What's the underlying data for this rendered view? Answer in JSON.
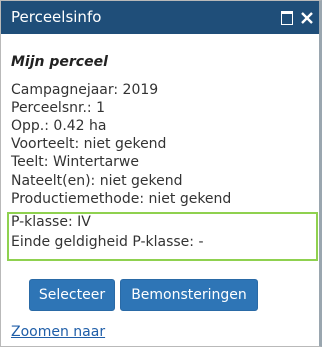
{
  "window": {
    "title": "Perceelsinfo",
    "maximize_icon": "maximize-icon",
    "close_icon": "close-icon",
    "close_glyph": "✕"
  },
  "panel": {
    "heading": "Mijn perceel",
    "lines": [
      "Campagnejaar: 2019",
      "Perceelsnr.: 1",
      "Opp.: 0.42 ha",
      "Voorteelt: niet gekend",
      "Teelt: Wintertarwe",
      "Nateelt(en): niet gekend",
      "Productiemethode: niet gekend"
    ],
    "highlighted_lines": [
      "P-klasse: IV",
      "Einde geldigheid P-klasse: -"
    ]
  },
  "actions": {
    "select_label": "Selecteer",
    "samples_label": "Bemonsteringen",
    "zoom_label": "Zoomen naar"
  },
  "colors": {
    "titlebar": "#1f4e79",
    "button": "#2e75b6",
    "highlight": "#8fd14f",
    "link": "#1f5ea8"
  }
}
